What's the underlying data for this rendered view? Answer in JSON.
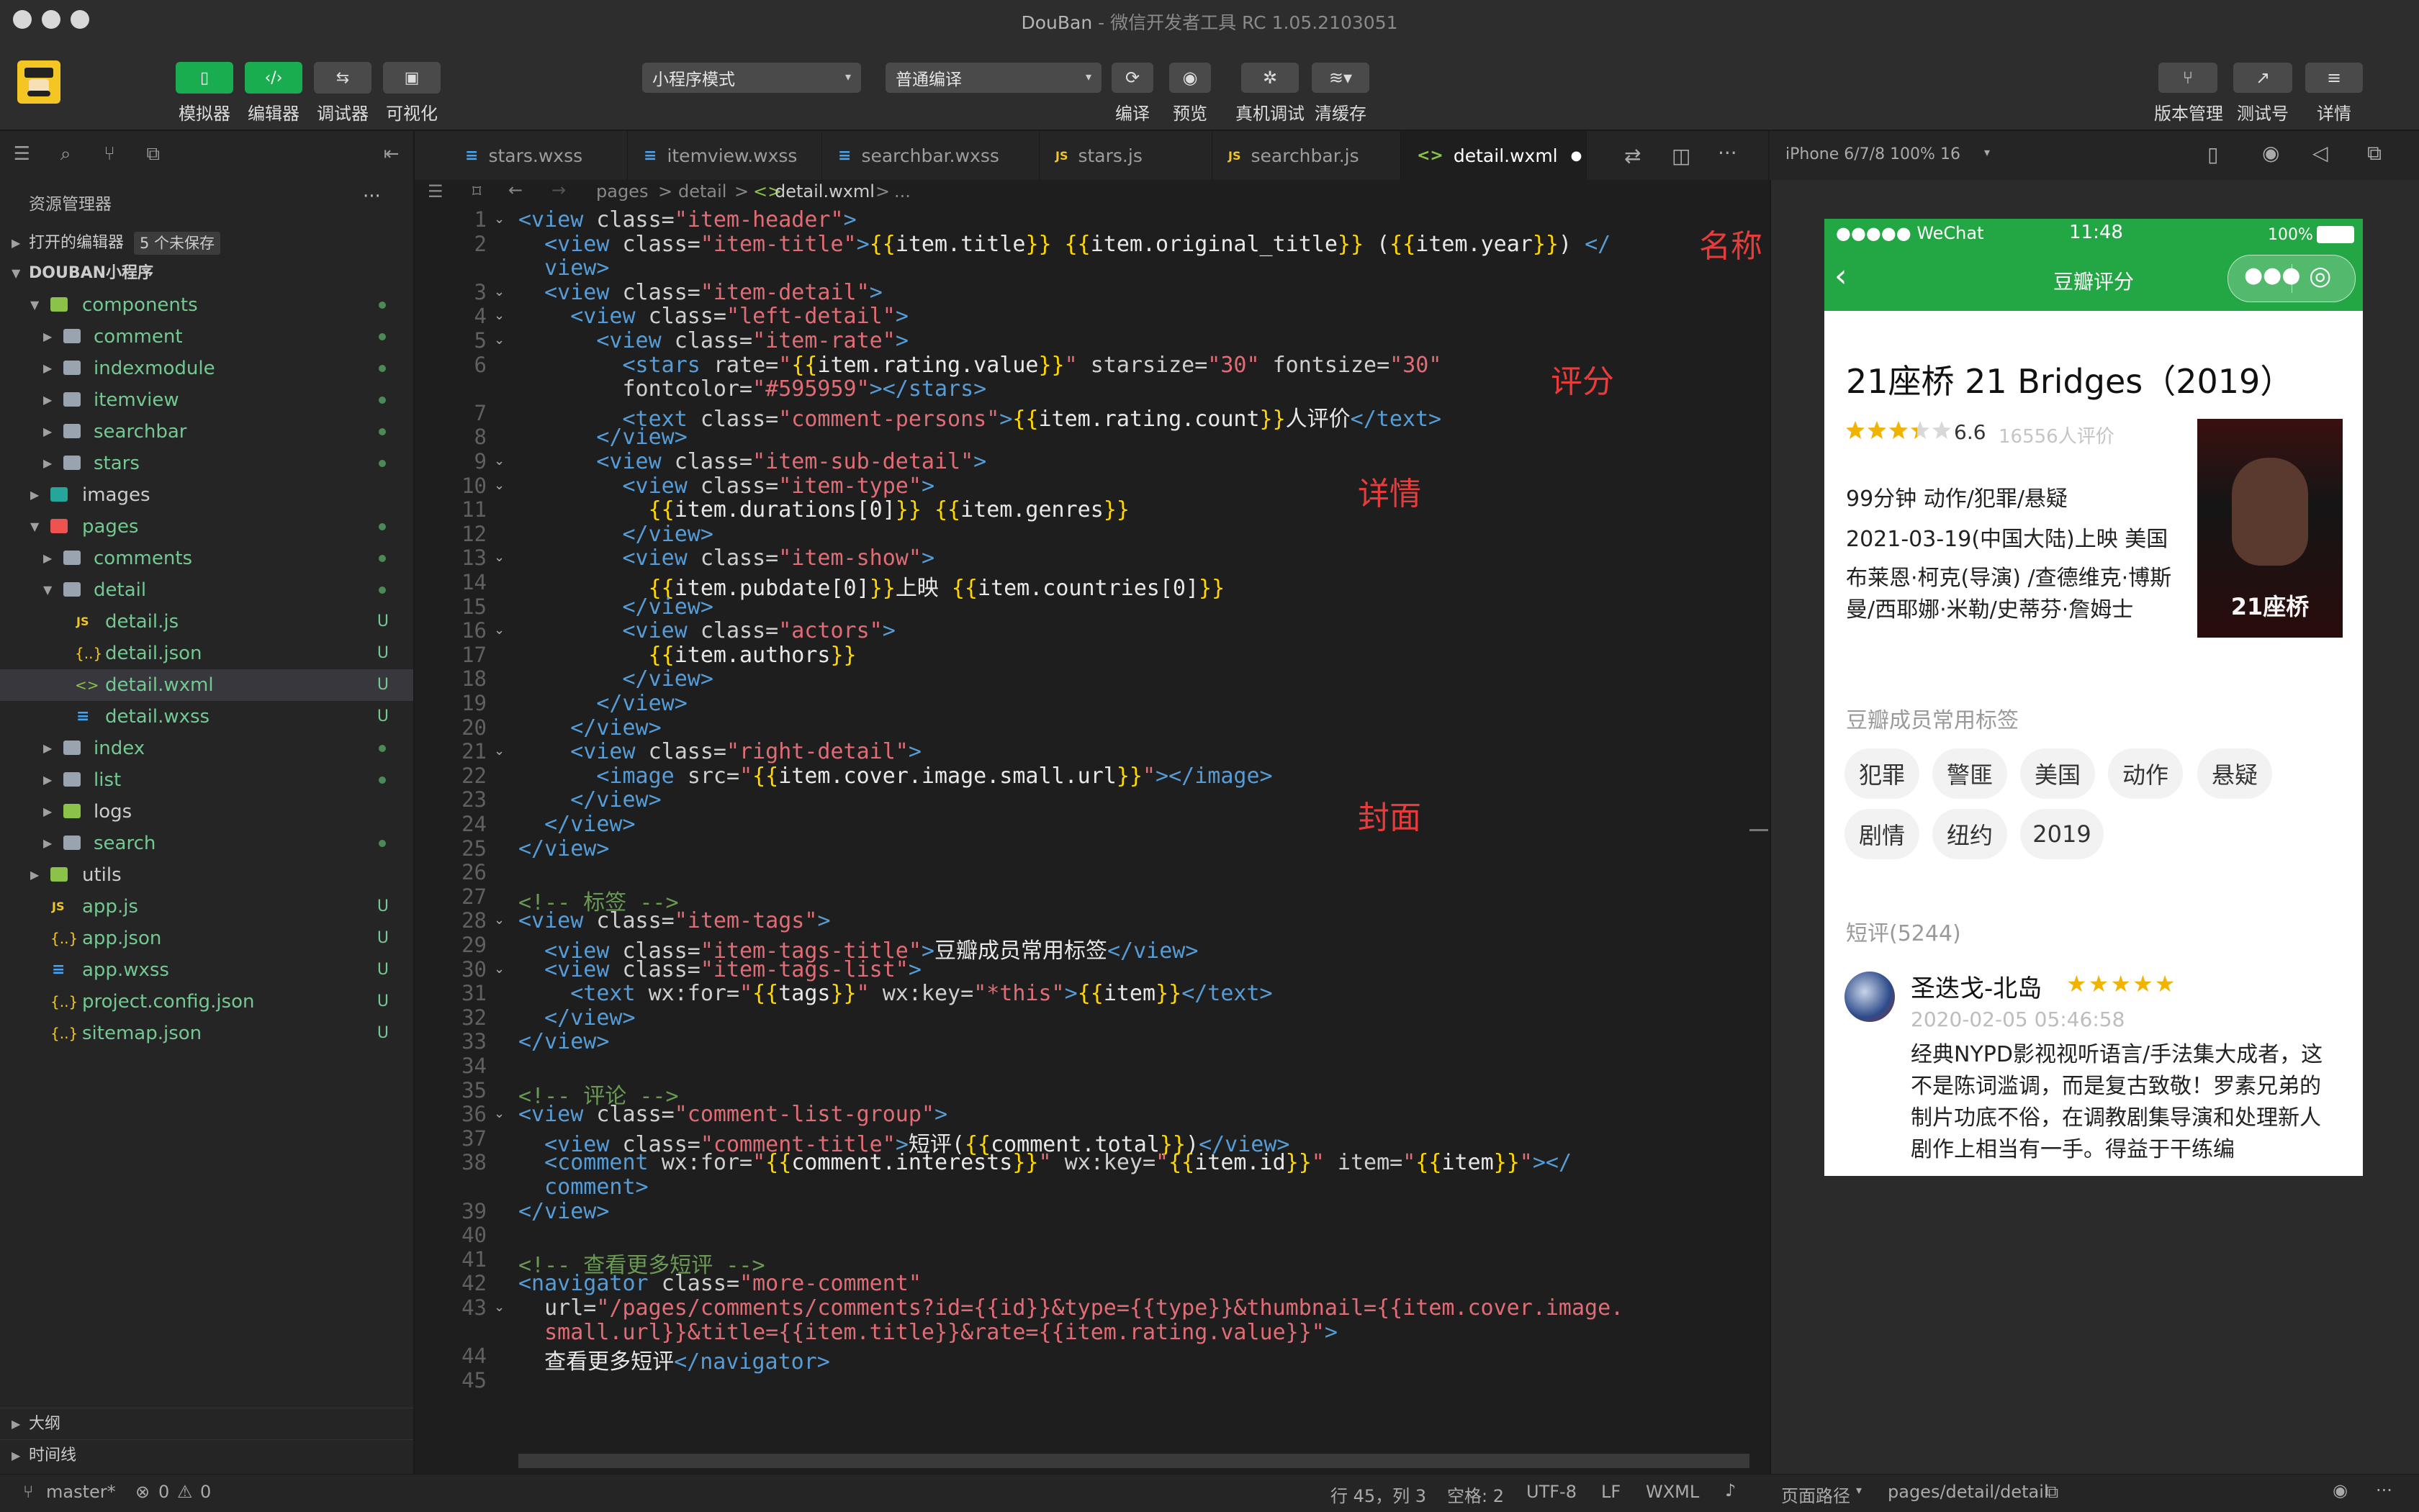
{
  "window": {
    "title": "DouBan",
    "subtitle": "- 微信开发者工具 RC 1.05.2103051"
  },
  "toolbar": {
    "left_buttons": [
      "模拟器",
      "编辑器",
      "调试器",
      "可视化"
    ],
    "mode_select": "小程序模式",
    "compile_select": "普通编译",
    "mid_buttons": [
      "编译",
      "预览",
      "真机调试",
      "清缓存"
    ],
    "right_buttons": [
      "版本管理",
      "测试号",
      "详情"
    ]
  },
  "sidebar": {
    "title": "资源管理器",
    "more": "···",
    "open_editors": "打开的编辑器",
    "unsaved": "5 个未保存",
    "project": "DOUBAN小程序",
    "rows": [
      {
        "label": "components",
        "status": ""
      },
      {
        "label": "comment",
        "status": ""
      },
      {
        "label": "indexmodule",
        "status": ""
      },
      {
        "label": "itemview",
        "status": ""
      },
      {
        "label": "searchbar",
        "status": ""
      },
      {
        "label": "stars",
        "status": ""
      },
      {
        "label": "images",
        "status": ""
      },
      {
        "label": "pages",
        "status": ""
      },
      {
        "label": "comments",
        "status": ""
      },
      {
        "label": "detail",
        "status": ""
      },
      {
        "label": "detail.js",
        "status": "U"
      },
      {
        "label": "detail.json",
        "status": "U"
      },
      {
        "label": "detail.wxml",
        "status": "U"
      },
      {
        "label": "detail.wxss",
        "status": "U"
      },
      {
        "label": "index",
        "status": ""
      },
      {
        "label": "list",
        "status": ""
      },
      {
        "label": "logs",
        "status": ""
      },
      {
        "label": "search",
        "status": ""
      },
      {
        "label": "utils",
        "status": ""
      },
      {
        "label": "app.js",
        "status": "U"
      },
      {
        "label": "app.json",
        "status": "U"
      },
      {
        "label": "app.wxss",
        "status": "U"
      },
      {
        "label": "project.config.json",
        "status": "U"
      },
      {
        "label": "sitemap.json",
        "status": "U"
      }
    ],
    "outline": "大纲",
    "timeline": "时间线"
  },
  "tabs": [
    {
      "label": "stars.wxss",
      "icon": "≡"
    },
    {
      "label": "itemview.wxss",
      "icon": "≡"
    },
    {
      "label": "searchbar.wxss",
      "icon": "≡"
    },
    {
      "label": "stars.js",
      "icon": "JS"
    },
    {
      "label": "searchbar.js",
      "icon": "JS"
    },
    {
      "label": "detail.wxml",
      "icon": "<>"
    }
  ],
  "breadcrumb": {
    "parts": [
      "pages",
      ">",
      "detail",
      ">",
      "detail.wxml",
      ">",
      "..."
    ]
  },
  "code_lines": {
    "n": [
      "1",
      "2",
      "",
      "3",
      "4",
      "5",
      "6",
      "",
      "7",
      "8",
      "9",
      "10",
      "11",
      "12",
      "13",
      "14",
      "15",
      "16",
      "17",
      "18",
      "19",
      "20",
      "21",
      "22",
      "23",
      "24",
      "25",
      "26",
      "27",
      "28",
      "29",
      "30",
      "31",
      "32",
      "33",
      "34",
      "35",
      "36",
      "37",
      "38",
      "",
      "39",
      "40",
      "41",
      "42",
      "43",
      "",
      "44",
      "45"
    ]
  },
  "annotations": {
    "name": "名称",
    "rating": "评分",
    "detail": "详情",
    "cover": "封面"
  },
  "status": {
    "branch": "master*",
    "errors": "0",
    "warnings": "0",
    "position": "行 45，列 3",
    "spaces": "空格: 2",
    "encoding": "UTF-8",
    "eol": "LF",
    "lang": "WXML",
    "page_path_label": "页面路径",
    "page_path": "pages/detail/detail"
  },
  "simulator": {
    "device": "iPhone 6/7/8 100% 16",
    "carrier": "●●●●● WeChat",
    "time": "11:48",
    "battery": "100%",
    "nav_title": "豆瓣评分",
    "movie_title": "21座桥 21 Bridges（2019）",
    "rating": "6.6",
    "rating_fraction": 0.66,
    "rating_count": "16556人评价",
    "duration_genres": "99分钟 动作/犯罪/悬疑",
    "release": "2021-03-19(中国大陆)上映 美国",
    "authors": "布莱恩·柯克(导演) /查德维克·博斯曼/西耶娜·米勒/史蒂芬·詹姆士",
    "tags_title": "豆瓣成员常用标签",
    "tags": [
      "犯罪",
      "警匪",
      "美国",
      "动作",
      "悬疑",
      "剧情",
      "纽约",
      "2019"
    ],
    "comments_title": "短评(5244)",
    "comment": {
      "user": "圣迭戈-北岛",
      "stars": "★★★★★",
      "date": "2020-02-05 05:46:58",
      "text": "经典NYPD影视视听语言/手法集大成者，这不是陈词滥调，而是复古致敬！罗素兄弟的制片功底不俗，在调教剧集导演和处理新人剧作上相当有一手。得益于干练编"
    },
    "poster_text": "21座桥"
  }
}
